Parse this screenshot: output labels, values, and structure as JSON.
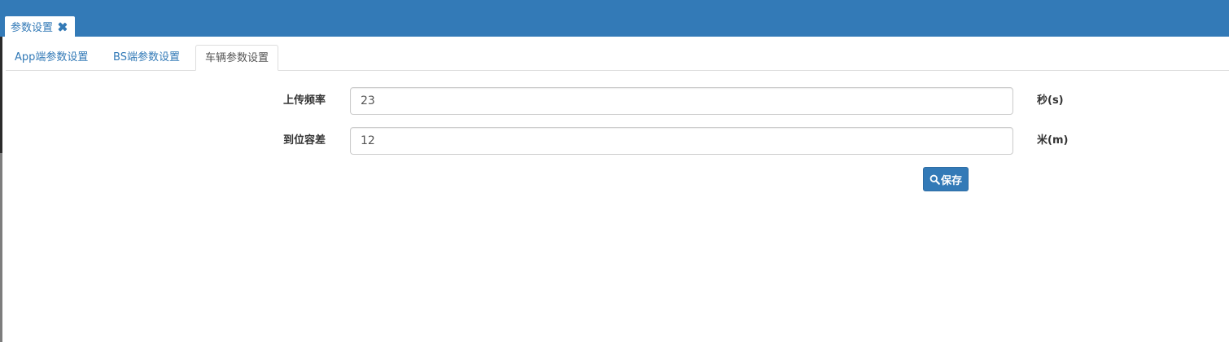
{
  "header": {
    "tab_label": "参数设置",
    "tab_close_icon": "close-icon",
    "bar_color": "#337ab7"
  },
  "subtabs": [
    {
      "label": "App端参数设置",
      "active": false
    },
    {
      "label": "BS端参数设置",
      "active": false
    },
    {
      "label": "车辆参数设置",
      "active": true
    }
  ],
  "form": {
    "fields": [
      {
        "label": "上传频率",
        "value": "23",
        "unit": "秒(s)"
      },
      {
        "label": "到位容差",
        "value": "12",
        "unit": "米(m)"
      }
    ],
    "save_button": {
      "label": "保存",
      "icon": "search-icon"
    }
  }
}
